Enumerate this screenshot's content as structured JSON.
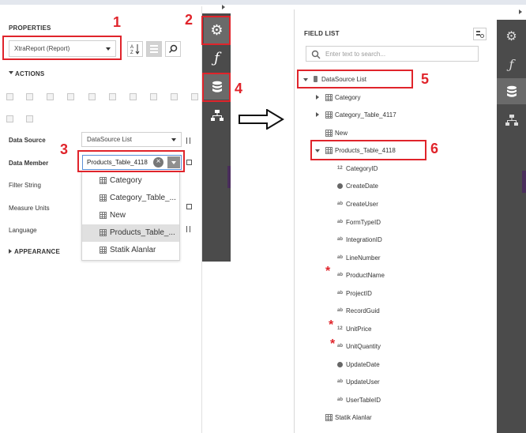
{
  "properties": {
    "title": "PROPERTIES",
    "selected_object": "XtraReport (Report)",
    "sections": {
      "actions": "ACTIONS",
      "appearance": "APPEARANCE"
    },
    "rows": [
      {
        "label": "Data Source",
        "value": "DataSource List"
      },
      {
        "label": "Data Member",
        "value": "Products_Table_4118"
      },
      {
        "label": "Filter String"
      },
      {
        "label": "Measure Units"
      },
      {
        "label": "Language"
      }
    ],
    "data_member_dropdown": [
      "Category",
      "Category_Table_...",
      "New",
      "Products_Table_...",
      "Statik Alanlar"
    ],
    "selected_dropdown_item": 3
  },
  "field_list": {
    "title": "FIELD LIST",
    "search_placeholder": "Enter text to search...",
    "root": "DataSource List",
    "items": [
      {
        "label": "Category"
      },
      {
        "label": "Category_Table_4117"
      },
      {
        "label": "New"
      },
      {
        "label": "Products_Table_4118"
      }
    ],
    "fields": [
      {
        "label": "CategoryID",
        "type": "number"
      },
      {
        "label": "CreateDate",
        "type": "date"
      },
      {
        "label": "CreateUser",
        "type": "text"
      },
      {
        "label": "FormTypeID",
        "type": "text"
      },
      {
        "label": "IntegrationID",
        "type": "text"
      },
      {
        "label": "LineNumber",
        "type": "text"
      },
      {
        "label": "ProductName",
        "type": "string"
      },
      {
        "label": "ProjectID",
        "type": "text"
      },
      {
        "label": "RecordGuid",
        "type": "string"
      },
      {
        "label": "UnitPrice",
        "type": "number"
      },
      {
        "label": "UnitQuantity",
        "type": "string"
      },
      {
        "label": "UpdateDate",
        "type": "date"
      },
      {
        "label": "UpdateUser",
        "type": "text"
      },
      {
        "label": "UserTableID",
        "type": "text"
      }
    ],
    "last_item": "Statik Alanlar"
  },
  "annotations": [
    "1",
    "2",
    "3",
    "4",
    "5",
    "6"
  ],
  "icons": {
    "gear": "⚙",
    "function": "ƒ",
    "database": "database-icon",
    "tree": "tree-icon",
    "search": "search-icon",
    "field_list_settings": "settings-icon",
    "sort_az": "sort-az-icon",
    "categories": "categories-icon",
    "clear": "×"
  },
  "colors": {
    "annotation_red": "#e0242b",
    "toolbar_dark": "#4b4b4b",
    "toolbar_active": "#6a6a6a",
    "accent_purple": "#4a2e5c"
  }
}
